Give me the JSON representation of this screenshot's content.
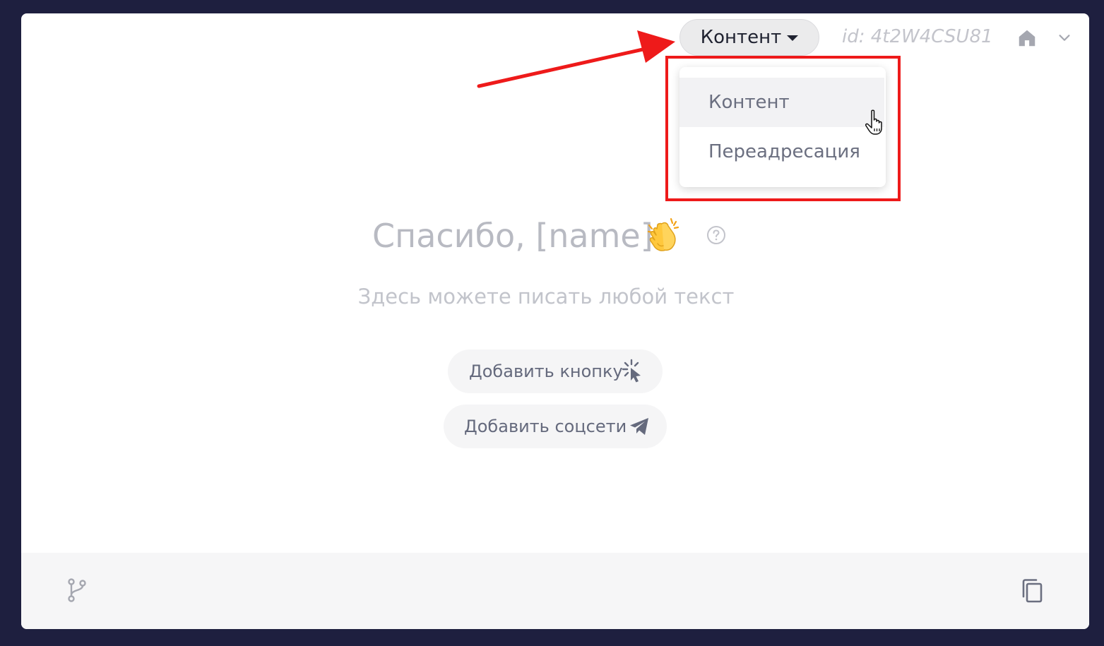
{
  "header": {
    "type_select_label": "Контент",
    "block_id": "id: 4t2W4CSU81"
  },
  "type_menu": {
    "items": [
      {
        "label": "Контент",
        "active": true
      },
      {
        "label": "Переадресация",
        "active": false
      }
    ]
  },
  "content": {
    "title": "Спасибо, [name]!",
    "subtitle": "Здесь можете писать любой текст"
  },
  "actions": {
    "add_button_label": "Добавить кнопку",
    "add_social_label": "Добавить соцсети"
  },
  "colors": {
    "annotation": "#ee1a1a",
    "background": "#1e1f3f"
  },
  "icons": [
    "home-icon",
    "chevron-down-icon",
    "clap-emoji-icon",
    "help-icon",
    "click-cursor-icon",
    "send-icon",
    "branch-icon",
    "copy-icon",
    "hand-pointer-icon"
  ]
}
